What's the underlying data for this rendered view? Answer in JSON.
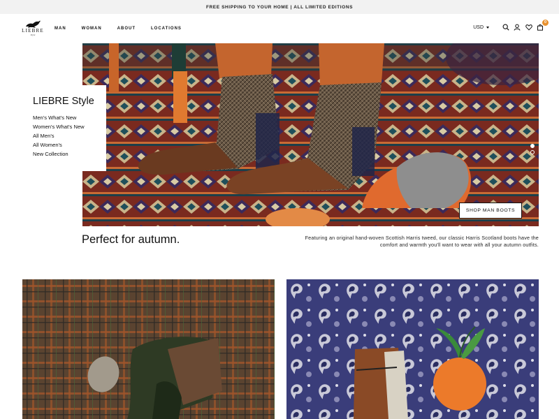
{
  "announcement": "FREE SHIPPING TO YOUR HOME | ALL LIMITED EDITIONS",
  "brand": {
    "name": "LIEBRE",
    "sub": "Style"
  },
  "nav": [
    {
      "label": "MAN"
    },
    {
      "label": "WOMAN"
    },
    {
      "label": "ABOUT"
    },
    {
      "label": "LOCATIONS"
    }
  ],
  "header": {
    "currency": "USD",
    "cart_count": "0",
    "icons": [
      "search-icon",
      "user-icon",
      "heart-icon",
      "bag-icon"
    ]
  },
  "hero": {
    "card_title": "LIEBRE Style",
    "links": [
      "Men's What's New",
      "Women's What's New",
      "All Men's",
      "All Women's",
      "New Collection"
    ],
    "cta": "SHOP MAN BOOTS",
    "slides_total": 2,
    "active_slide": 1
  },
  "feature": {
    "tagline": "Perfect for autumn.",
    "description": "Featuring an original hand-woven Scottish Harris tweed, our classic Harris Scotland boots have the comfort and warmth you'll want to wear with all your autumn outfits."
  },
  "colors": {
    "accent": "#e8912e",
    "rug_red": "#8a2a1e",
    "tweed": "#5a4430",
    "paisley": "#3a3d7a"
  }
}
